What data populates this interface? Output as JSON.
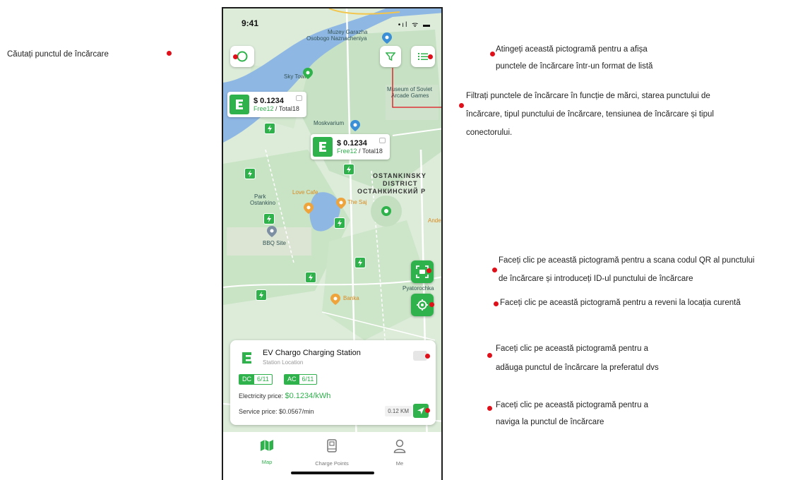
{
  "annotations": {
    "search": "Căutați punctul de încărcare",
    "list_line1": "Atingeți această pictogramă pentru a afișa",
    "list_line2": "punctele de încărcare într-un format de listă",
    "filter_line1": "Filtrați punctele de încărcare în funcție de mărci, starea punctului de",
    "filter_line2": "încărcare, tipul punctului de încărcare, tensiunea de încărcare și tipul",
    "filter_line3": "conectorului.",
    "scan_line1": "Faceți clic pe această pictogramă pentru a scana codul QR al punctului",
    "scan_line2": "de încărcare și introduceți ID-ul punctului de încărcare",
    "locate": "Faceți clic pe această pictogramă pentru a reveni la locația curentă",
    "fav_line1": "Faceți clic pe această pictogramă pentru a",
    "fav_line2": "adăuga punctul de încărcare la preferatul dvs",
    "nav_line1": "Faceți clic pe această pictogramă pentru a",
    "nav_line2": "naviga la punctul de încărcare"
  },
  "status_bar": {
    "time": "9:41",
    "icons": "•ıl ᯤ ▬"
  },
  "map": {
    "labels": {
      "muzey": "Muzey Garazha",
      "osobogo": "Osobogo Naznacheniya",
      "skytown": "Sky Town",
      "museum": "Museum of Soviet",
      "arcade": "Arcade Games",
      "moskvarium": "Moskvarium",
      "district1": "OSTANKINSKY",
      "district2": "DISTRICT",
      "district3": "ОСТАНКИНСКИЙ Р",
      "park1": "Park",
      "park2": "Ostankino",
      "lovecafe": "Love Cafe",
      "thesaj": "The Saj",
      "bbq": "BBQ Site",
      "banka": "Banka",
      "pyat": "Pyatorochka",
      "ande": "Ande"
    },
    "bubble1": {
      "price": "$ 0.1234",
      "free": "Free12",
      "sep": " / ",
      "total": "Total18"
    },
    "bubble2": {
      "price": "$ 0.1234",
      "free": "Free12",
      "sep": " / ",
      "total": "Total18"
    }
  },
  "station_card": {
    "name": "EV Chargo Charging Station",
    "location": "Station Location",
    "dc_label": "DC",
    "dc_value": "6/11",
    "ac_label": "AC",
    "ac_value": "6/11",
    "electricity_label": "Electricity price: ",
    "electricity_value": "$0.1234/kWh",
    "service_label": "Service price: ",
    "service_value": "$0.0567/min",
    "distance": "0.12 KM"
  },
  "tabbar": {
    "tabs": [
      {
        "label": "Map",
        "active": true
      },
      {
        "label": "Charge Points",
        "active": false
      },
      {
        "label": "Me",
        "active": false
      }
    ]
  },
  "colors": {
    "accent": "#2fb24c",
    "annotation_dot": "#e0101b"
  }
}
